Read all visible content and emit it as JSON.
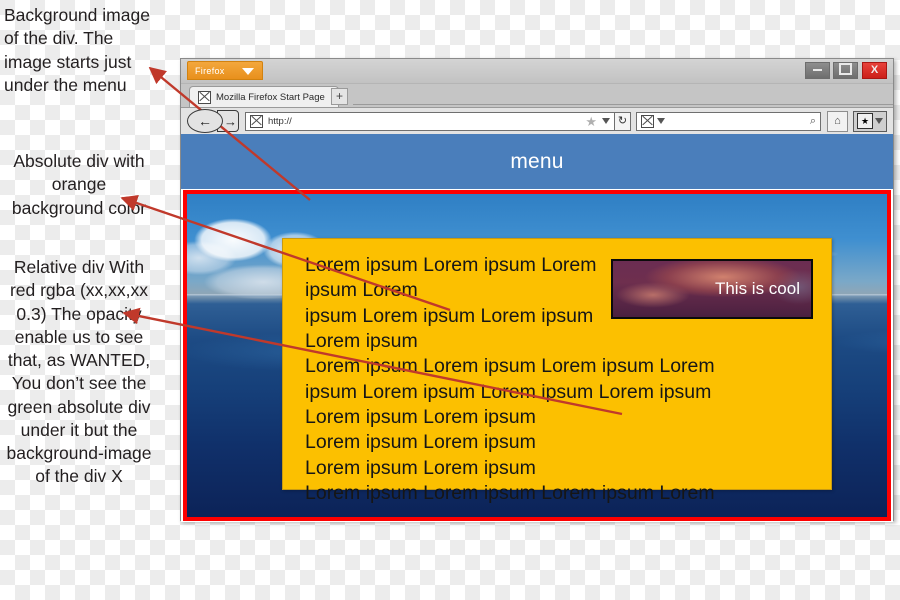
{
  "annotations": {
    "background_note": "Background image of the div. The image starts just under the menu",
    "absolute_note": "Absolute div with orange background color",
    "relative_note": "Relative div With red rgba (xx,xx,xx 0.3) The opacity enable us to see that, as WANTED, You don’t see the green absolute div under it but the background-image of the div X"
  },
  "browser": {
    "app_button": "Firefox",
    "window_controls": {
      "minimize": "–",
      "maximize": "□",
      "close": "X"
    },
    "tab": {
      "title": "Mozilla Firefox Start Page",
      "new_tab": "+"
    },
    "toolbar": {
      "back": "←",
      "forward": "→",
      "url_value": "http://",
      "url_placeholder": "http://",
      "bookmark_star": "★",
      "reload": "↻",
      "search_value": "",
      "search_placeholder": "",
      "magnifier": "⌕",
      "home": "⌂",
      "bookmarks": "★"
    }
  },
  "page": {
    "menu_label": "menu",
    "lorem_lines": [
      "Lorem ipsum Lorem ipsum Lorem ipsum Lorem",
      "ipsum Lorem ipsum Lorem ipsum Lorem ipsum",
      "Lorem ipsum Lorem ipsum Lorem ipsum Lorem",
      "ipsum Lorem ipsum Lorem ipsum Lorem ipsum",
      "Lorem ipsum Lorem ipsum",
      "Lorem ipsum Lorem ipsum",
      "Lorem ipsum Lorem ipsum",
      "Lorem ipsum Lorem ipsum Lorem ipsum Lorem"
    ],
    "cool_box_label": "This is cool"
  },
  "colors": {
    "menu_blue": "#4a7ebb",
    "orange": "#fcc000",
    "red_border": "#fe0000",
    "firefox_orange": "#e8901c",
    "close_red": "#cc1f18",
    "arrow_red": "#c0392b"
  }
}
